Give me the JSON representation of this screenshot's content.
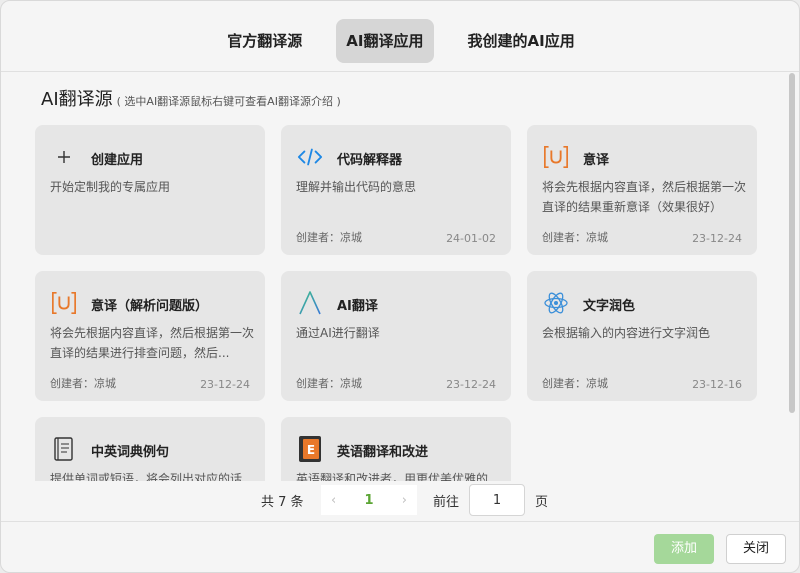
{
  "tabs": [
    {
      "label": "官方翻译源"
    },
    {
      "label": "AI翻译应用"
    },
    {
      "label": "我创建的AI应用"
    }
  ],
  "active_tab": 1,
  "section": {
    "title": "AI翻译源",
    "hint": "( 选中AI翻译源鼠标右键可查看AI翻译源介绍 )"
  },
  "cards": [
    {
      "name": "创建应用",
      "desc": "开始定制我的专属应用",
      "creator": "",
      "date": "",
      "icon": "plus-icon"
    },
    {
      "name": "代码解释器",
      "desc": "理解并输出代码的意思",
      "creator": "创建者：凉城",
      "date": "24-01-02",
      "icon": "code-icon"
    },
    {
      "name": "意译",
      "desc": "将会先根据内容直译，然后根据第一次直译的结果重新意译（效果很好）",
      "creator": "创建者：凉城",
      "date": "23-12-24",
      "icon": "u-bracket-icon"
    },
    {
      "name": "意译（解析问题版）",
      "desc": "将会先根据内容直译，然后根据第一次直译的结果进行排查问题，然后...",
      "creator": "创建者：凉城",
      "date": "23-12-24",
      "icon": "u-bracket-icon"
    },
    {
      "name": "AI翻译",
      "desc": "通过AI进行翻译",
      "creator": "创建者：凉城",
      "date": "23-12-24",
      "icon": "caret-a-icon"
    },
    {
      "name": "文字润色",
      "desc": "会根据输入的内容进行文字润色",
      "creator": "创建者：凉城",
      "date": "23-12-16",
      "icon": "atom-icon"
    },
    {
      "name": "中英词典例句",
      "desc": "提供单词或短语，将会列出对应的话",
      "creator": "",
      "date": "",
      "icon": "book-icon"
    },
    {
      "name": "英语翻译和改进",
      "desc": "英语翻译和改进者，用更优美优雅的",
      "creator": "",
      "date": "",
      "icon": "e-book-icon"
    }
  ],
  "pagination": {
    "total": "共 7 条",
    "prev": "‹",
    "current": "1",
    "next": "›",
    "goto_label": "前往",
    "goto_value": "1",
    "unit": "页"
  },
  "footer": {
    "add_label": "添加",
    "close_label": "关闭"
  },
  "colors": {
    "accent": "#5ba534",
    "add_button": "#a5d89a",
    "icon_orange": "#e8782a",
    "icon_blue": "#1e88e5"
  }
}
